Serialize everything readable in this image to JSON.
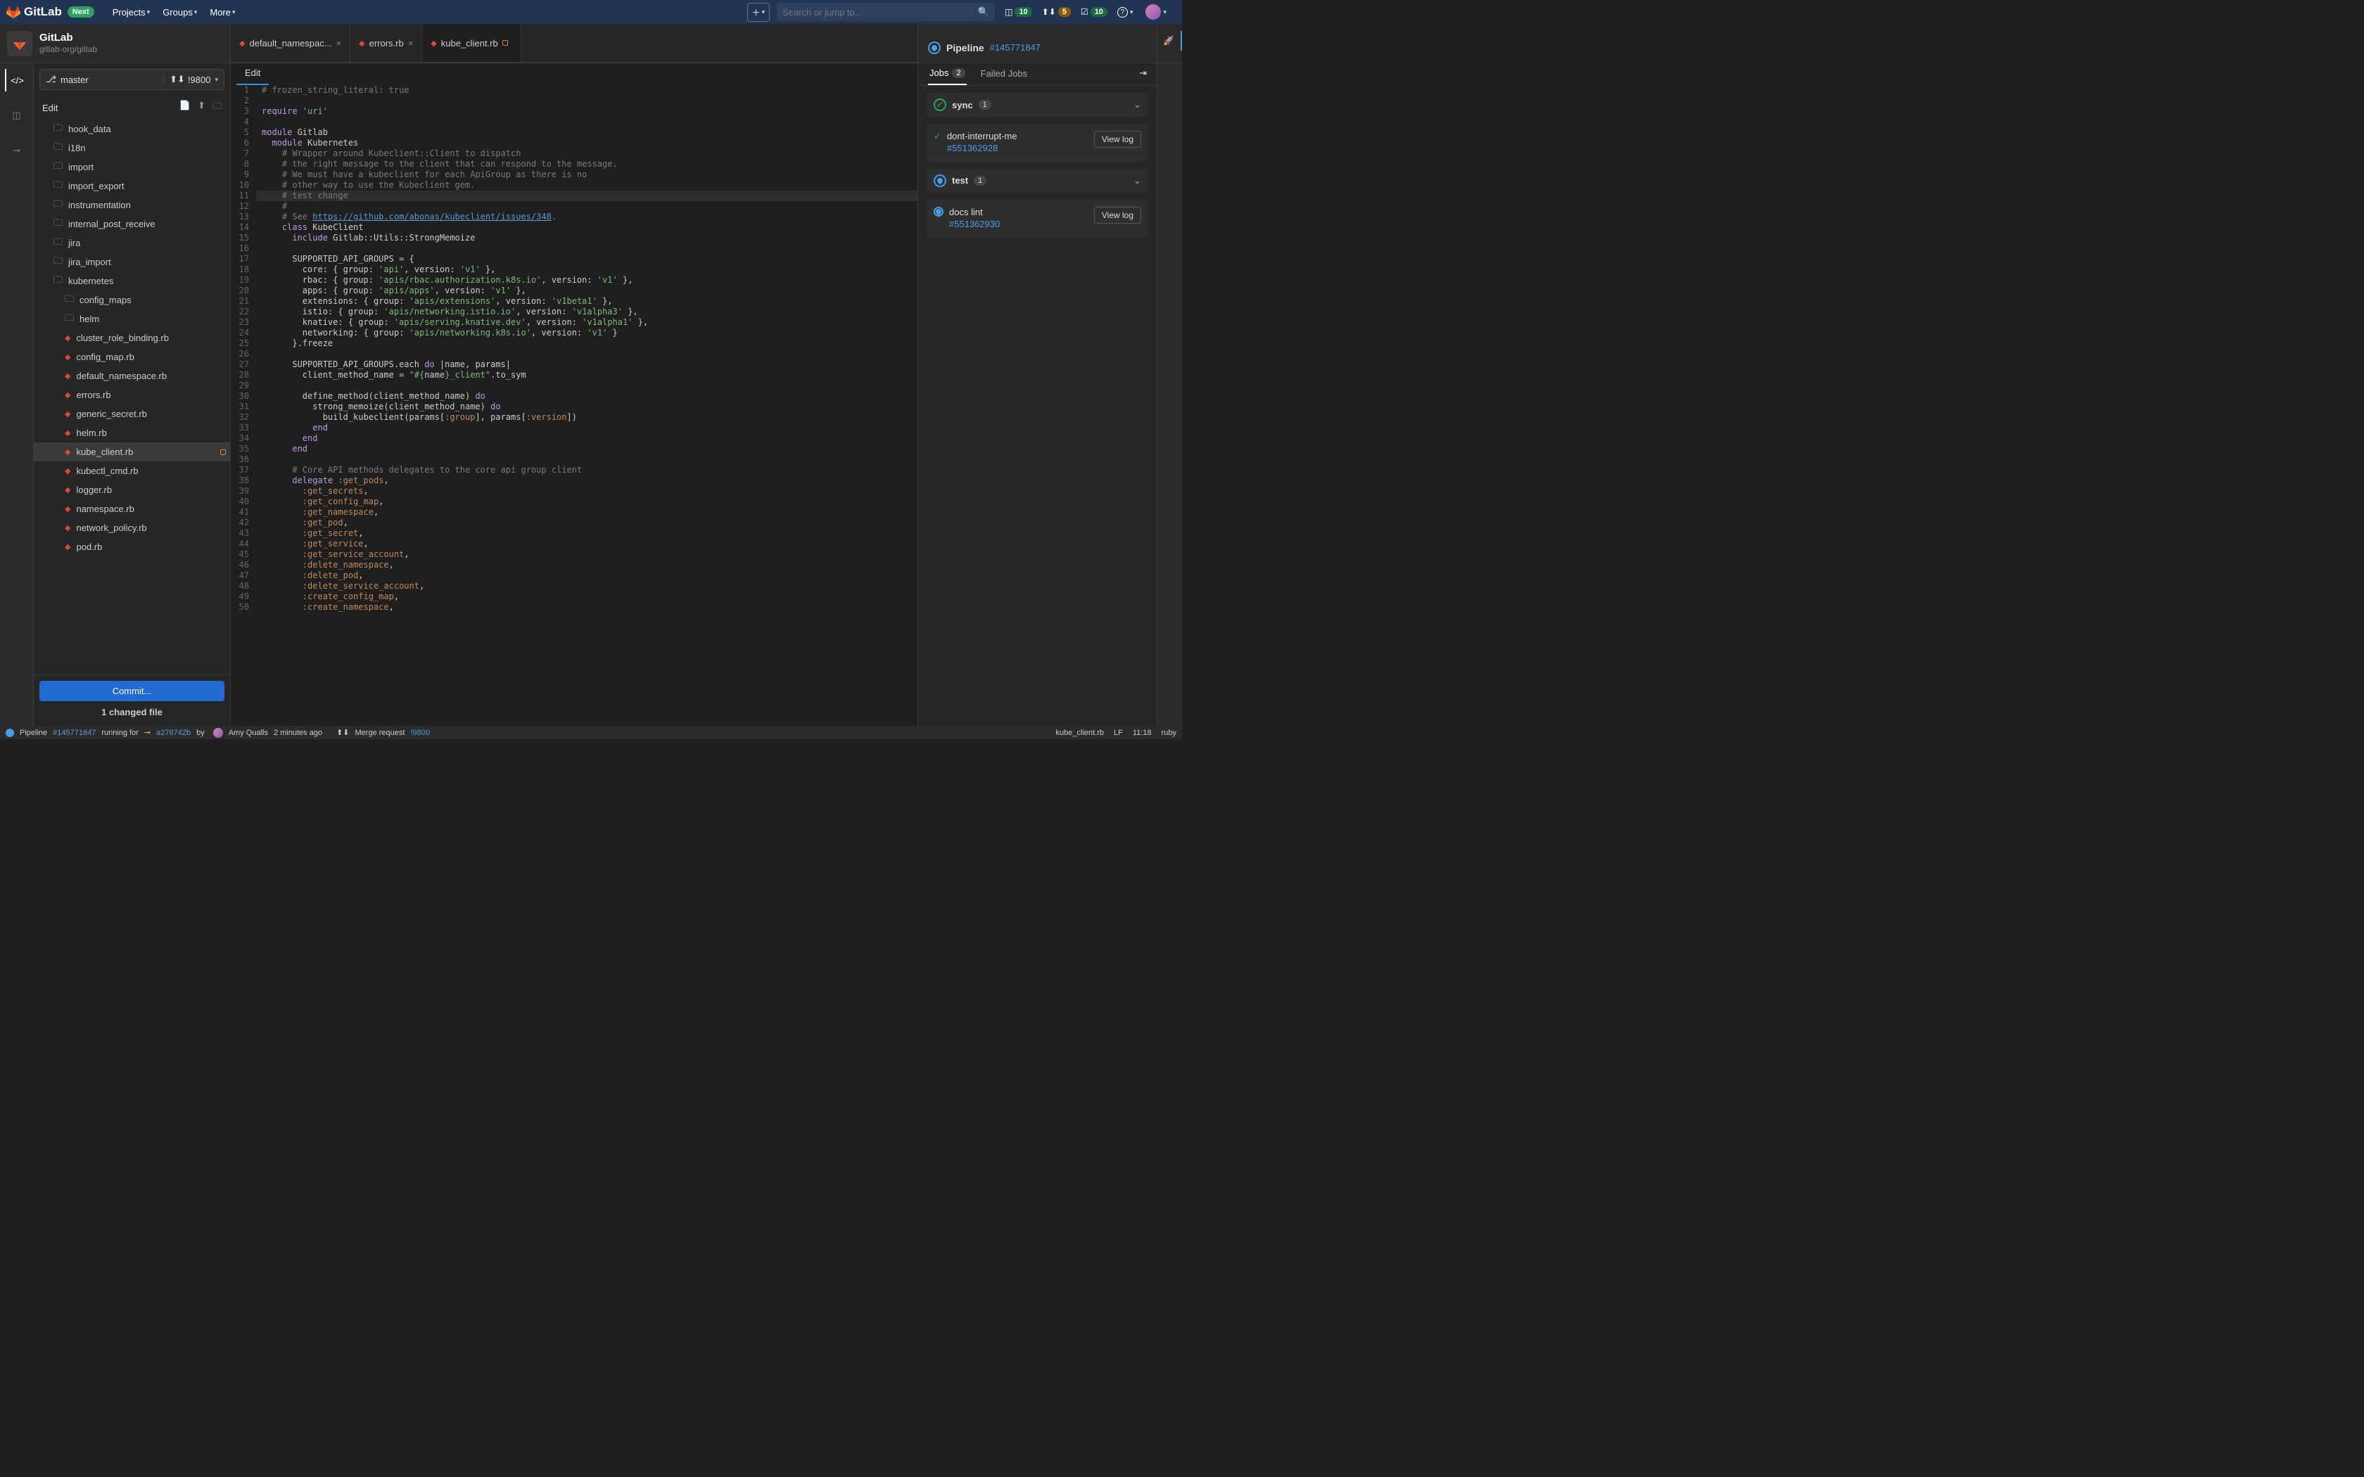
{
  "nav": {
    "brand": "GitLab",
    "next": "Next",
    "menu": [
      "Projects",
      "Groups",
      "More"
    ],
    "search_placeholder": "Search or jump to...",
    "issues_count": "10",
    "mrs_count": "5",
    "todos_count": "10"
  },
  "project": {
    "name": "GitLab",
    "path": "gitlab-org/gitlab"
  },
  "sidebar": {
    "branch": "master",
    "mr_ref": "!9800",
    "edit_label": "Edit",
    "commit_btn": "Commit...",
    "changed_files": "1 changed file",
    "tree": [
      {
        "type": "folder",
        "name": "hook_data",
        "depth": 1
      },
      {
        "type": "folder",
        "name": "i18n",
        "depth": 1
      },
      {
        "type": "folder",
        "name": "import",
        "depth": 1
      },
      {
        "type": "folder",
        "name": "import_export",
        "depth": 1
      },
      {
        "type": "folder",
        "name": "instrumentation",
        "depth": 1
      },
      {
        "type": "folder",
        "name": "internal_post_receive",
        "depth": 1
      },
      {
        "type": "folder",
        "name": "jira",
        "depth": 1
      },
      {
        "type": "folder",
        "name": "jira_import",
        "depth": 1
      },
      {
        "type": "folder",
        "name": "kubernetes",
        "depth": 1,
        "open": true
      },
      {
        "type": "folder",
        "name": "config_maps",
        "depth": 2
      },
      {
        "type": "folder",
        "name": "helm",
        "depth": 2
      },
      {
        "type": "ruby",
        "name": "cluster_role_binding.rb",
        "depth": 2
      },
      {
        "type": "ruby",
        "name": "config_map.rb",
        "depth": 2
      },
      {
        "type": "ruby",
        "name": "default_namespace.rb",
        "depth": 2
      },
      {
        "type": "ruby",
        "name": "errors.rb",
        "depth": 2
      },
      {
        "type": "ruby",
        "name": "generic_secret.rb",
        "depth": 2
      },
      {
        "type": "ruby",
        "name": "helm.rb",
        "depth": 2
      },
      {
        "type": "ruby",
        "name": "kube_client.rb",
        "depth": 2,
        "active": true,
        "modified": true
      },
      {
        "type": "ruby",
        "name": "kubectl_cmd.rb",
        "depth": 2
      },
      {
        "type": "ruby",
        "name": "logger.rb",
        "depth": 2
      },
      {
        "type": "ruby",
        "name": "namespace.rb",
        "depth": 2
      },
      {
        "type": "ruby",
        "name": "network_policy.rb",
        "depth": 2
      },
      {
        "type": "ruby",
        "name": "pod.rb",
        "depth": 2
      }
    ]
  },
  "tabs": [
    {
      "name": "default_namespac...",
      "icon": "ruby"
    },
    {
      "name": "errors.rb",
      "icon": "ruby"
    },
    {
      "name": "kube_client.rb",
      "icon": "ruby",
      "active": true,
      "modified": true
    }
  ],
  "editor": {
    "edit_tab": "Edit",
    "highlight_line": 11,
    "lines": [
      {
        "n": 1,
        "html": "<span class='c-comment'># frozen_string_literal: true</span>"
      },
      {
        "n": 2,
        "html": ""
      },
      {
        "n": 3,
        "html": "<span class='c-keyword'>require</span> <span class='c-string'>'uri'</span>"
      },
      {
        "n": 4,
        "html": ""
      },
      {
        "n": 5,
        "html": "<span class='c-keyword'>module</span> Gitlab"
      },
      {
        "n": 6,
        "html": "  <span class='c-keyword'>module</span> Kubernetes"
      },
      {
        "n": 7,
        "html": "    <span class='c-comment'># Wrapper around Kubeclient::Client to dispatch</span>"
      },
      {
        "n": 8,
        "html": "    <span class='c-comment'># the right message to the client that can respond to the message.</span>"
      },
      {
        "n": 9,
        "html": "    <span class='c-comment'># We must have a kubeclient for each ApiGroup as there is no</span>"
      },
      {
        "n": 10,
        "html": "    <span class='c-comment'># other way to use the Kubeclient gem.</span>"
      },
      {
        "n": 11,
        "html": "    <span class='c-comment'># test change</span>"
      },
      {
        "n": 12,
        "html": "    <span class='c-comment'>#</span>"
      },
      {
        "n": 13,
        "html": "    <span class='c-comment'># See </span><span class='c-link'>https://github.com/abonas/kubeclient/issues/348</span><span class='c-comment'>.</span>"
      },
      {
        "n": 14,
        "html": "    <span class='c-keyword'>class</span> KubeClient"
      },
      {
        "n": 15,
        "html": "      <span class='c-keyword'>include</span> Gitlab::Utils::StrongMemoize"
      },
      {
        "n": 16,
        "html": ""
      },
      {
        "n": 17,
        "html": "      SUPPORTED_API_GROUPS = {"
      },
      {
        "n": 18,
        "html": "        core: { group: <span class='c-string'>'api'</span>, version: <span class='c-string'>'v1'</span> },"
      },
      {
        "n": 19,
        "html": "        rbac: { group: <span class='c-string'>'apis/rbac.authorization.k8s.io'</span>, version: <span class='c-string'>'v1'</span> },"
      },
      {
        "n": 20,
        "html": "        apps: { group: <span class='c-string'>'apis/apps'</span>, version: <span class='c-string'>'v1'</span> },"
      },
      {
        "n": 21,
        "html": "        extensions: { group: <span class='c-string'>'apis/extensions'</span>, version: <span class='c-string'>'v1beta1'</span> },"
      },
      {
        "n": 22,
        "html": "        istio: { group: <span class='c-string'>'apis/networking.istio.io'</span>, version: <span class='c-string'>'v1alpha3'</span> },"
      },
      {
        "n": 23,
        "html": "        knative: { group: <span class='c-string'>'apis/serving.knative.dev'</span>, version: <span class='c-string'>'v1alpha1'</span> },"
      },
      {
        "n": 24,
        "html": "        networking: { group: <span class='c-string'>'apis/networking.k8s.io'</span>, version: <span class='c-string'>'v1'</span> }"
      },
      {
        "n": 25,
        "html": "      }.freeze"
      },
      {
        "n": 26,
        "html": ""
      },
      {
        "n": 27,
        "html": "      SUPPORTED_API_GROUPS.each <span class='c-keyword'>do</span> |name, params|"
      },
      {
        "n": 28,
        "html": "        client_method_name = <span class='c-string'>\"#{</span>name<span class='c-string'>}_client\"</span>.to_sym"
      },
      {
        "n": 29,
        "html": ""
      },
      {
        "n": 30,
        "html": "        define_method(client_method_name) <span class='c-keyword'>do</span>"
      },
      {
        "n": 31,
        "html": "          strong_memoize(client_method_name) <span class='c-keyword'>do</span>"
      },
      {
        "n": 32,
        "html": "            build_kubeclient(params[<span class='c-symbol'>:group</span>], params[<span class='c-symbol'>:version</span>])"
      },
      {
        "n": 33,
        "html": "          <span class='c-keyword'>end</span>"
      },
      {
        "n": 34,
        "html": "        <span class='c-keyword'>end</span>"
      },
      {
        "n": 35,
        "html": "      <span class='c-keyword'>end</span>"
      },
      {
        "n": 36,
        "html": ""
      },
      {
        "n": 37,
        "html": "      <span class='c-comment'># Core API methods delegates to the core api group client</span>"
      },
      {
        "n": 38,
        "html": "      <span class='c-keyword'>delegate</span> <span class='c-symbol'>:get_pods</span>,"
      },
      {
        "n": 39,
        "html": "        <span class='c-symbol'>:get_secrets</span>,"
      },
      {
        "n": 40,
        "html": "        <span class='c-symbol'>:get_config_map</span>,"
      },
      {
        "n": 41,
        "html": "        <span class='c-symbol'>:get_namespace</span>,"
      },
      {
        "n": 42,
        "html": "        <span class='c-symbol'>:get_pod</span>,"
      },
      {
        "n": 43,
        "html": "        <span class='c-symbol'>:get_secret</span>,"
      },
      {
        "n": 44,
        "html": "        <span class='c-symbol'>:get_service</span>,"
      },
      {
        "n": 45,
        "html": "        <span class='c-symbol'>:get_service_account</span>,"
      },
      {
        "n": 46,
        "html": "        <span class='c-symbol'>:delete_namespace</span>,"
      },
      {
        "n": 47,
        "html": "        <span class='c-symbol'>:delete_pod</span>,"
      },
      {
        "n": 48,
        "html": "        <span class='c-symbol'>:delete_service_account</span>,"
      },
      {
        "n": 49,
        "html": "        <span class='c-symbol'>:create_config_map</span>,"
      },
      {
        "n": 50,
        "html": "        <span class='c-symbol'>:create_namespace</span>,"
      }
    ]
  },
  "pipeline": {
    "label": "Pipeline",
    "id": "#145771847",
    "tabs": {
      "jobs": "Jobs",
      "jobs_count": "2",
      "failed": "Failed Jobs"
    },
    "stages": [
      {
        "name": "sync",
        "count": "1",
        "status": "success",
        "jobs": [
          {
            "name": "dont-interrupt-me",
            "link": "#551362928",
            "status": "success"
          }
        ]
      },
      {
        "name": "test",
        "count": "1",
        "status": "running",
        "jobs": [
          {
            "name": "docs lint",
            "link": "#551362930",
            "status": "running"
          }
        ]
      }
    ],
    "viewlog": "View log"
  },
  "statusbar": {
    "pipeline_label": "Pipeline",
    "pipeline_id": "#145771847",
    "running_for": "running for",
    "commit": "a278742b",
    "by": "by",
    "author": "Amy Qualls",
    "time": "2 minutes ago",
    "mr_label": "Merge request",
    "mr_id": "!9800",
    "file": "kube_client.rb",
    "eol": "LF",
    "pos": "11:18",
    "lang": "ruby"
  }
}
